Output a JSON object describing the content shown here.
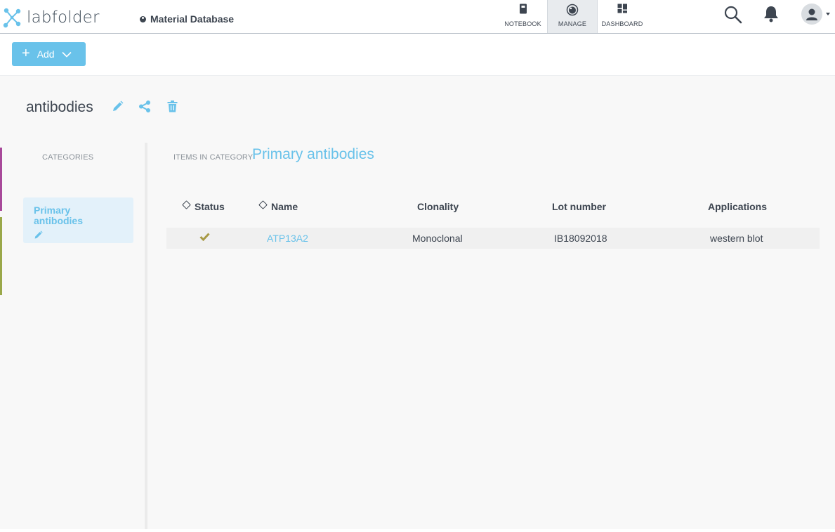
{
  "header": {
    "logo_text": "labfolder",
    "breadcrumb": "Material Database",
    "nav": [
      {
        "label": "NOTEBOOK",
        "icon": "notebook-icon"
      },
      {
        "label": "MANAGE",
        "icon": "manage-icon",
        "active": true
      },
      {
        "label": "DASHBOARD",
        "icon": "dashboard-icon"
      }
    ],
    "right_icons": [
      "search-icon",
      "bell-icon",
      "avatar-icon"
    ]
  },
  "toolbar": {
    "add_label": "Add"
  },
  "page": {
    "title": "antibodies",
    "title_actions": [
      "edit-icon",
      "share-icon",
      "delete-icon"
    ]
  },
  "sidebar": {
    "heading": "CATEGORIES",
    "categories": [
      {
        "label": "Primary antibodies",
        "active": true
      }
    ]
  },
  "main": {
    "items_heading": "ITEMS IN CATEGORY",
    "category_name": "Primary antibodies",
    "columns": [
      "Status",
      "Name",
      "Clonality",
      "Lot number",
      "Applications"
    ],
    "rows": [
      {
        "status": "check",
        "name": "ATP13A2",
        "clonality": "Monoclonal",
        "lot_number": "IB18092018",
        "applications": "western blot"
      }
    ]
  },
  "colors": {
    "accent": "#69c2ea",
    "text": "#3d4550",
    "check": "#a89a45",
    "category_accent_1": "#a8499a",
    "category_accent_2": "#9aa84a"
  }
}
